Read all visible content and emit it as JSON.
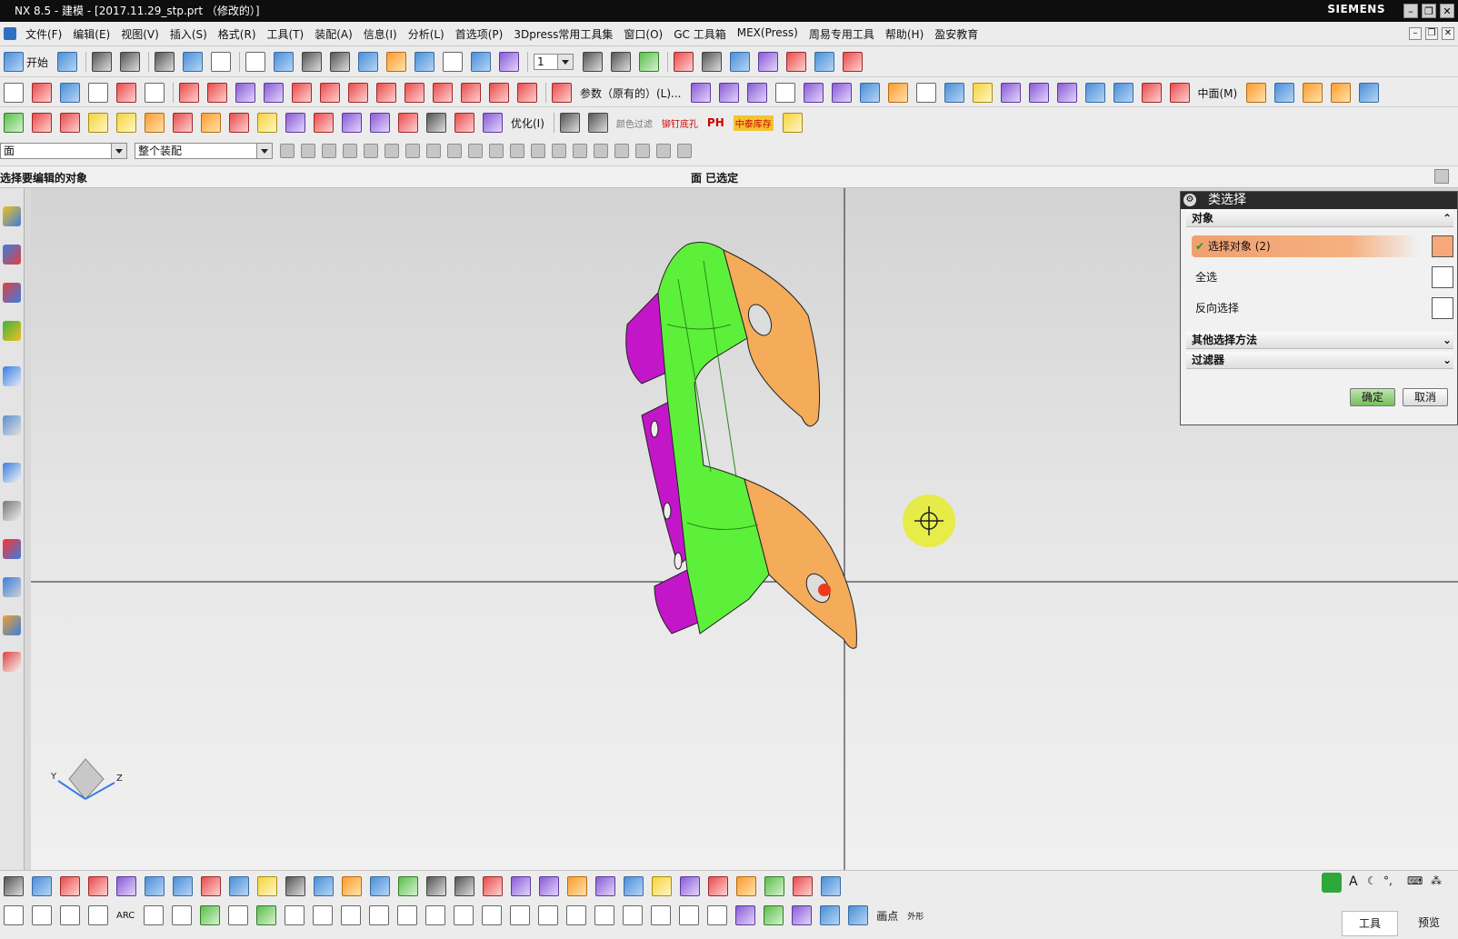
{
  "window": {
    "title": "NX 8.5 - 建模 - [2017.11.29_stp.prt （修改的）]",
    "brand": "SIEMENS",
    "controls": [
      "–",
      "❐",
      "✕"
    ]
  },
  "menu": {
    "items": [
      "文件(F)",
      "编辑(E)",
      "视图(V)",
      "插入(S)",
      "格式(R)",
      "工具(T)",
      "装配(A)",
      "信息(I)",
      "分析(L)",
      "首选项(P)",
      "3Dpress常用工具集",
      "窗口(O)",
      "GC 工具箱",
      "MEX(Press)",
      "周易专用工具",
      "帮助(H)",
      "盈安教育"
    ]
  },
  "toolbar": {
    "start_label": "开始",
    "layer_value": "1",
    "param_label": "参数（原有的）(L)...",
    "center_label": "中面(M)",
    "optimize_label": "优化(I)",
    "color_filter_label": "颜色过滤",
    "rivet_label": "铆钉底孔",
    "ph_label": "PH",
    "stock_label": "中泰库存"
  },
  "selection_bar": {
    "type_filter": "面",
    "scope": "整个装配"
  },
  "status": {
    "prompt": "选择要编辑的对象",
    "message": "面 已选定"
  },
  "dialog": {
    "title": "类选择",
    "group_object": "对象",
    "select_object": "选择对象 (2)",
    "select_all": "全选",
    "invert_select": "反向选择",
    "other_methods": "其他选择方法",
    "filter": "过滤器",
    "ok": "确定",
    "cancel": "取消"
  },
  "triad": {
    "x": "Y",
    "y": "Z"
  },
  "bottom": {
    "arc_label": "ARC",
    "draw_point_label": "画点",
    "external_label": "外形",
    "tools_label": "工具",
    "preview_label": "预览"
  },
  "colors": {
    "part_green": "#5df03a",
    "part_orange": "#f4ab5a",
    "part_purple": "#c316c9",
    "cursor": "#e6ec2b",
    "ok_button": "#76be5c"
  }
}
